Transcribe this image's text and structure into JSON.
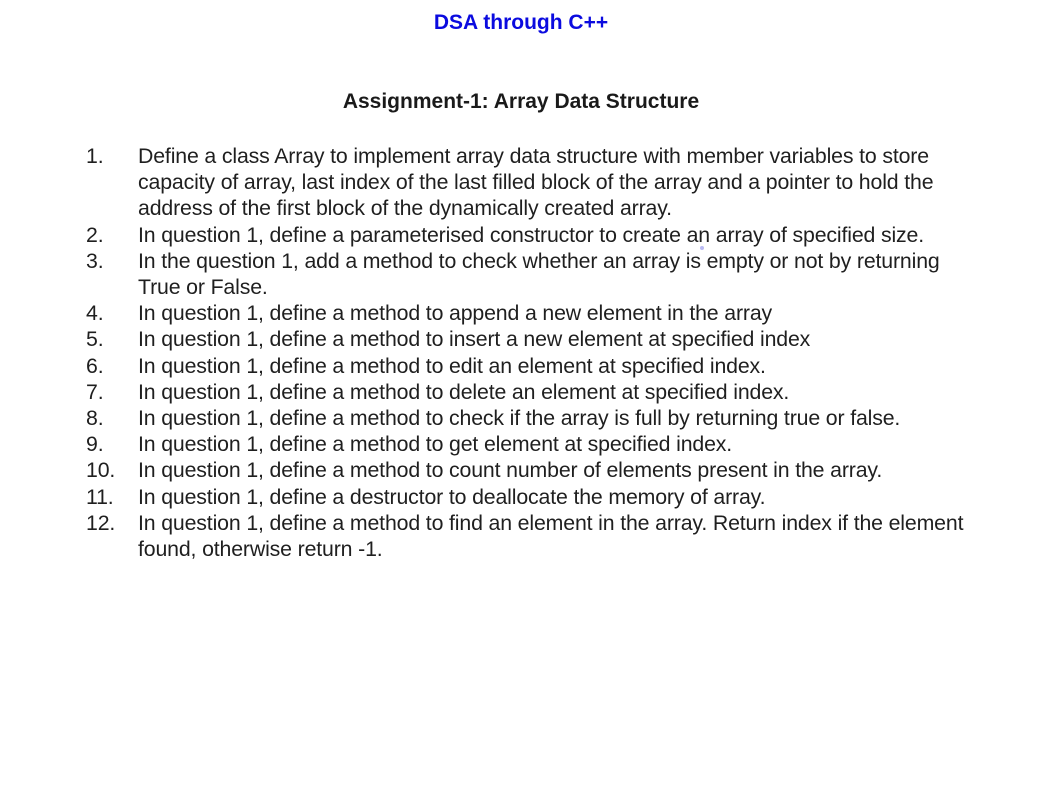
{
  "document": {
    "course_title": "DSA through C++",
    "assignment_title": "Assignment-1: Array Data Structure",
    "questions": [
      {
        "number": "1.",
        "text": "Define a class Array to implement array data structure with member variables to store capacity of array, last index of the last filled block of the array and a pointer to hold the address of the first block of the dynamically created array."
      },
      {
        "number": "2.",
        "text": "In question 1, define a parameterised constructor to create an array of specified size."
      },
      {
        "number": "3.",
        "text": "In the question 1, add a method to check whether an array is empty or not by returning True or False."
      },
      {
        "number": "4.",
        "text": "In question 1, define a method to append a new element in the array"
      },
      {
        "number": "5.",
        "text": "In question 1, define a method to insert a new element at specified index"
      },
      {
        "number": "6.",
        "text": "In question 1, define a method to edit an element at specified index."
      },
      {
        "number": "7.",
        "text": "In question 1, define a method to delete an element at specified index."
      },
      {
        "number": "8.",
        "text": "In question 1, define a method to check if the array is full by returning true or false."
      },
      {
        "number": "9.",
        "text": "In question 1, define a method to get element at specified index."
      },
      {
        "number": "10.",
        "text": "In question 1, define a method to count number of elements present in the array."
      },
      {
        "number": "11.",
        "text": "In question 1, define a destructor to deallocate the memory of array."
      },
      {
        "number": "12.",
        "text": "In question 1, define a method to find an element in the array. Return index if the element found, otherwise return -1."
      }
    ]
  }
}
